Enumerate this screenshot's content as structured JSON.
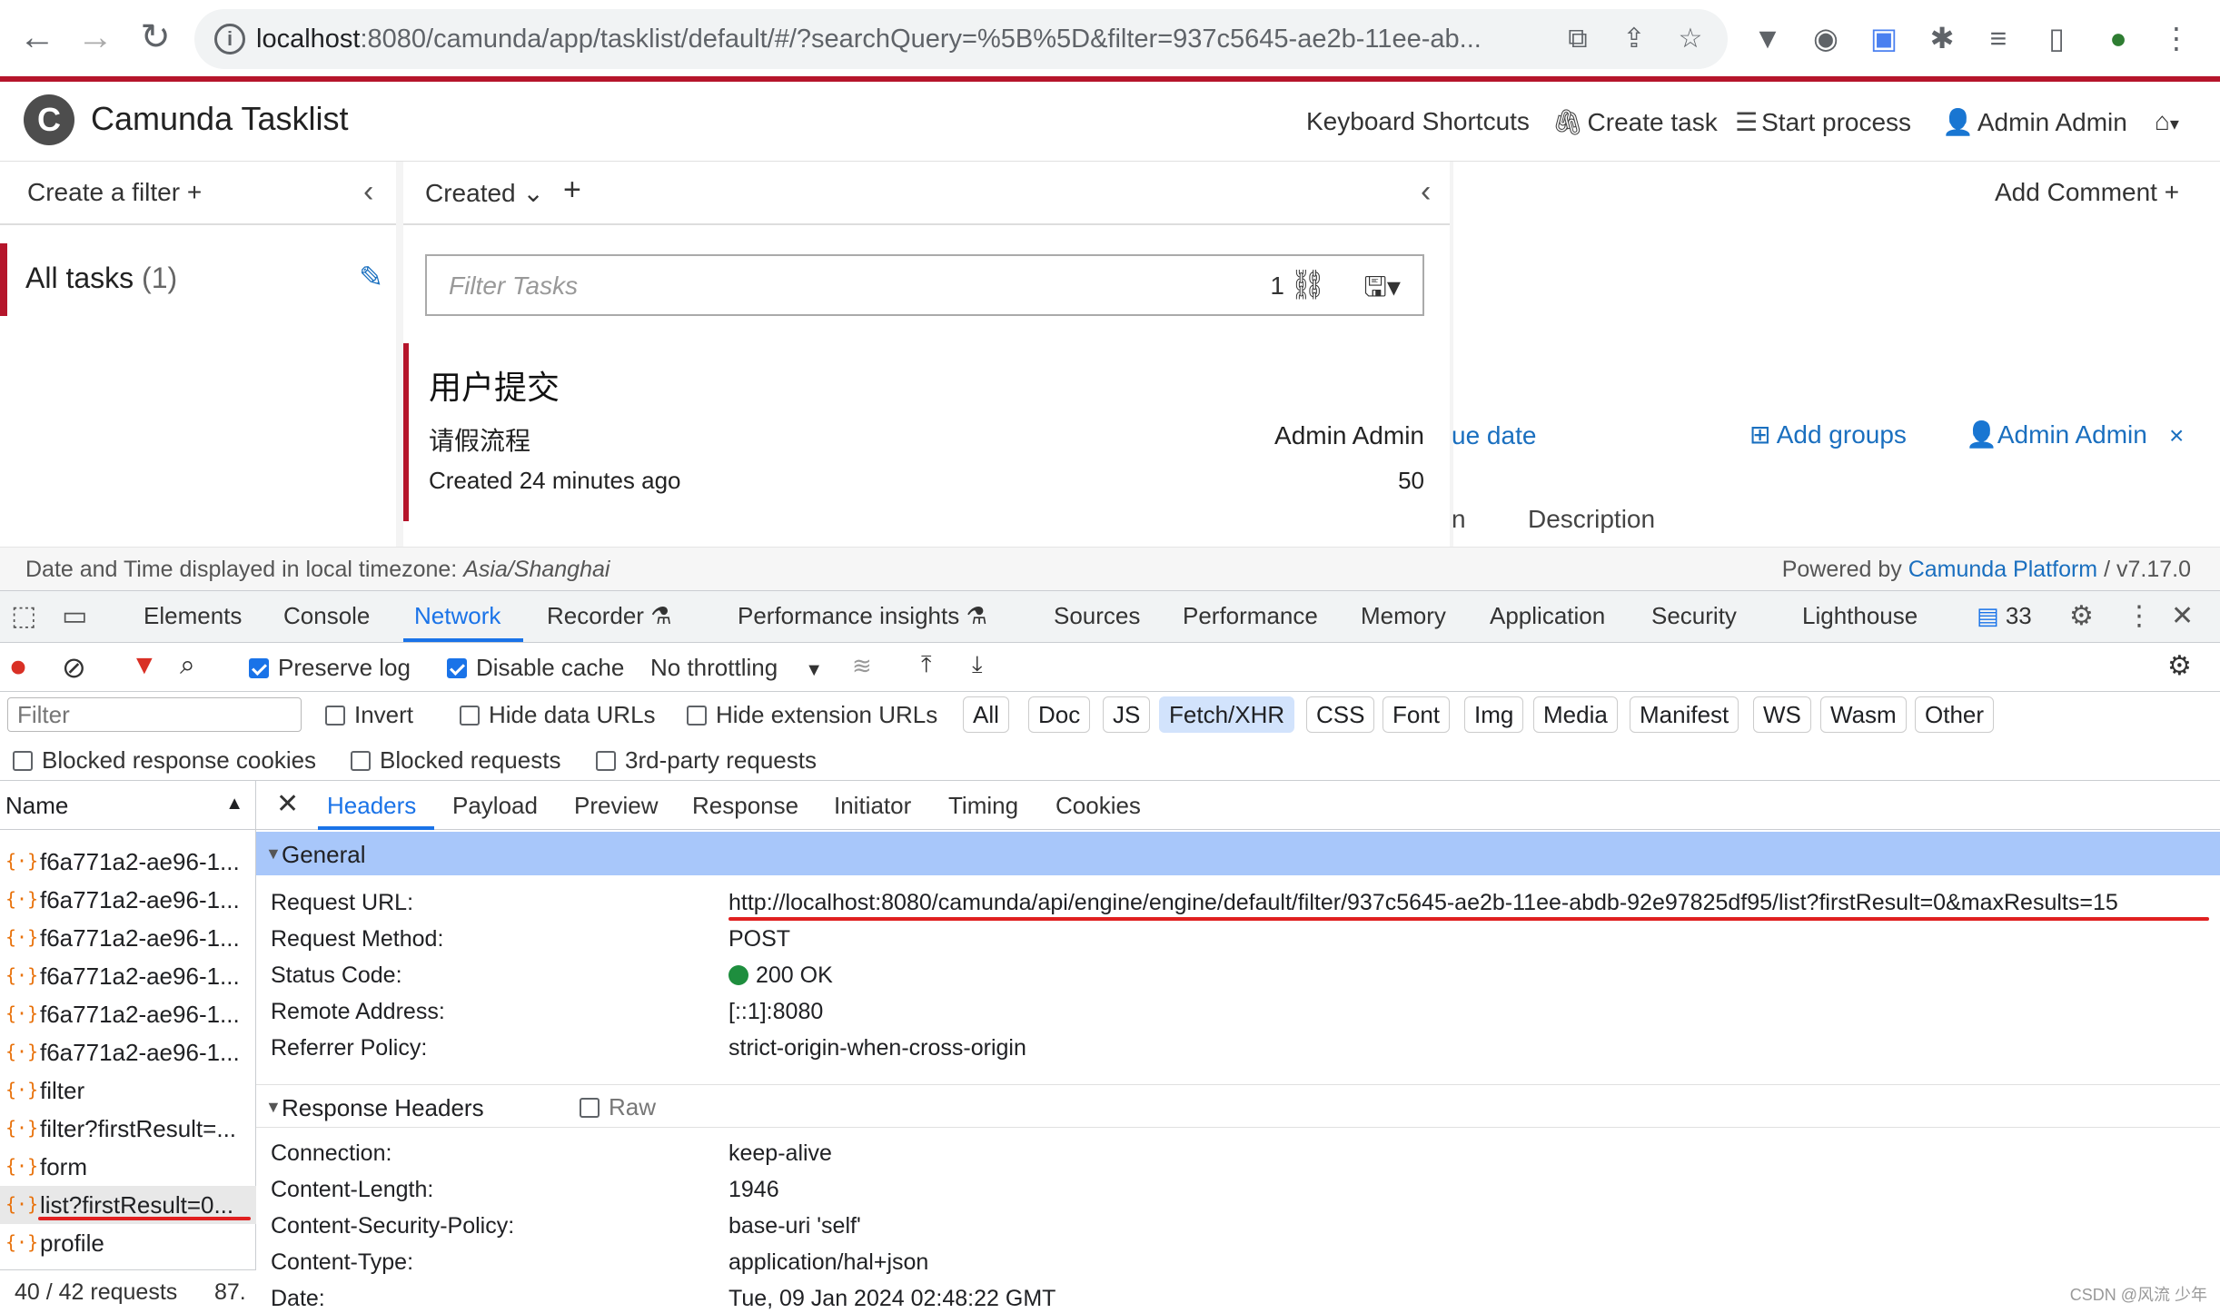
{
  "browser": {
    "url_host": "localhost",
    "url_rest": ":8080/camunda/app/tasklist/default/#/?searchQuery=%5B%5D&filter=937c5645-ae2b-11ee-ab..."
  },
  "app": {
    "logo_letter": "C",
    "title": "Camunda Tasklist",
    "header_links": {
      "shortcuts": "Keyboard Shortcuts",
      "create_task": "Create task",
      "start_process": "Start process",
      "user": "Admin Admin"
    }
  },
  "filters": {
    "create_label": "Create a filter +",
    "item_label": "All tasks",
    "item_count": "(1)"
  },
  "list": {
    "sort_label": "Created",
    "add": "+",
    "filter_placeholder": "Filter Tasks",
    "filter_count": "1",
    "task": {
      "name": "用户提交",
      "process": "请假流程",
      "assignee": "Admin Admin",
      "created": "Created 24 minutes ago",
      "priority": "50"
    }
  },
  "detail": {
    "add_comment": "Add Comment +",
    "due_date": "ue date",
    "add_groups": "Add groups",
    "assignee": "Admin Admin",
    "close": "×",
    "tab_fragment": "n",
    "tab_description": "Description"
  },
  "footer": {
    "timezone_prefix": "Date and Time displayed in local timezone:",
    "timezone": "Asia/Shanghai",
    "powered_prefix": "Powered by",
    "powered_link": "Camunda Platform",
    "version": "/ v7.17.0"
  },
  "devtools": {
    "tabs": [
      "Elements",
      "Console",
      "Network",
      "Recorder",
      "Performance insights",
      "Sources",
      "Performance",
      "Memory",
      "Application",
      "Security",
      "Lighthouse"
    ],
    "issues_count": "33",
    "preserve_log": "Preserve log",
    "disable_cache": "Disable cache",
    "throttling": "No throttling",
    "filter_placeholder": "Filter",
    "invert": "Invert",
    "hide_data_urls": "Hide data URLs",
    "hide_ext_urls": "Hide extension URLs",
    "types": [
      "All",
      "Doc",
      "JS",
      "Fetch/XHR",
      "CSS",
      "Font",
      "Img",
      "Media",
      "Manifest",
      "WS",
      "Wasm",
      "Other"
    ],
    "blocked_cookies": "Blocked response cookies",
    "blocked_requests": "Blocked requests",
    "third_party": "3rd-party requests",
    "name_header": "Name",
    "requests": [
      "f6a771a2-ae96-1...",
      "f6a771a2-ae96-1...",
      "f6a771a2-ae96-1...",
      "f6a771a2-ae96-1...",
      "f6a771a2-ae96-1...",
      "f6a771a2-ae96-1...",
      "filter",
      "filter?firstResult=...",
      "form",
      "list?firstResult=0...",
      "profile"
    ],
    "status_requests": "40 / 42 requests",
    "status_size": "87.",
    "detail_tabs": [
      "Headers",
      "Payload",
      "Preview",
      "Response",
      "Initiator",
      "Timing",
      "Cookies"
    ],
    "general_title": "General",
    "general": {
      "request_url_k": "Request URL:",
      "request_url_v": "http://localhost:8080/camunda/api/engine/engine/default/filter/937c5645-ae2b-11ee-abdb-92e97825df95/list?firstResult=0&maxResults=15",
      "method_k": "Request Method:",
      "method_v": "POST",
      "status_k": "Status Code:",
      "status_v": "200 OK",
      "remote_k": "Remote Address:",
      "remote_v": "[::1]:8080",
      "referrer_k": "Referrer Policy:",
      "referrer_v": "strict-origin-when-cross-origin"
    },
    "response_title": "Response Headers",
    "raw_label": "Raw",
    "response": {
      "conn_k": "Connection:",
      "conn_v": "keep-alive",
      "len_k": "Content-Length:",
      "len_v": "1946",
      "csp_k": "Content-Security-Policy:",
      "csp_v": "base-uri 'self'",
      "type_k": "Content-Type:",
      "type_v": "application/hal+json",
      "date_k": "Date:",
      "date_v": "Tue, 09 Jan 2024 02:48:22 GMT"
    }
  },
  "watermark": "CSDN @风流 少年"
}
